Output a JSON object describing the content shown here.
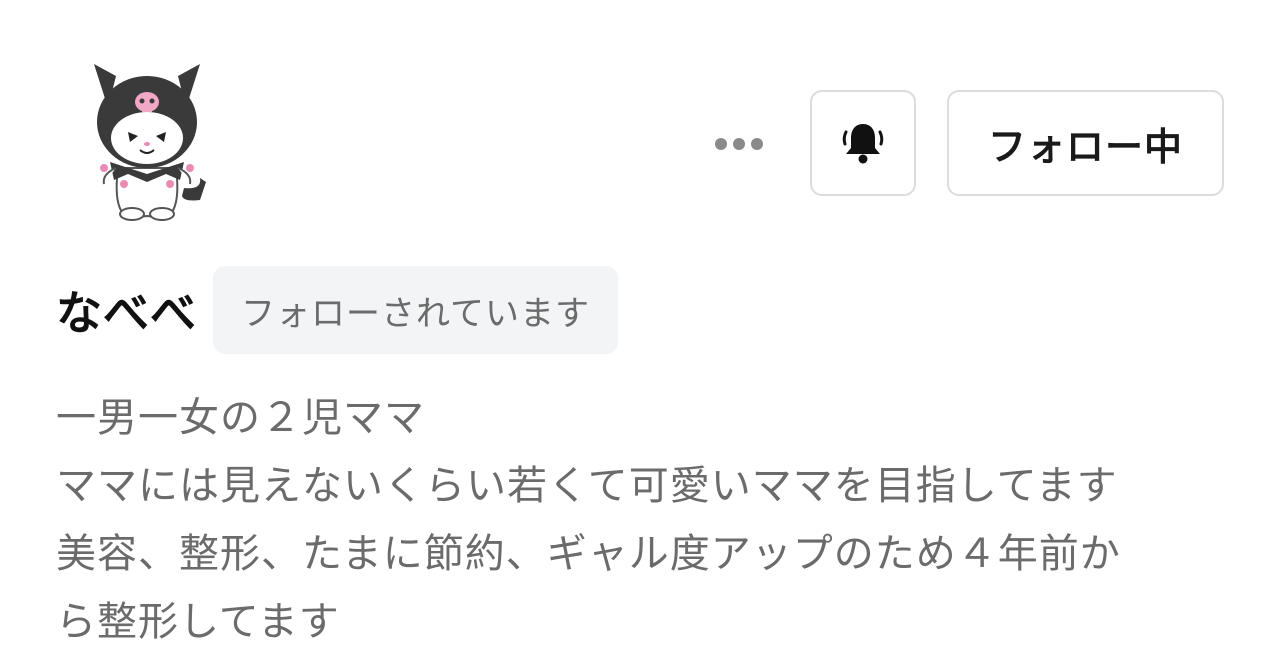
{
  "profile": {
    "name": "なべべ",
    "follows_you_badge": "フォローされています",
    "avatar_icon": "kuromi-character-avatar"
  },
  "actions": {
    "more_icon": "more-horizontal-icon",
    "bell_icon": "bell-filled-icon",
    "follow_label": "フォロー中"
  },
  "bio": {
    "lines": [
      "一男一女の２児ママ",
      "ママには見えないくらい若くて可愛いママを目指してます",
      "美容、整形、たまに節約、ギャル度アップのため４年前か",
      "ら整形してます"
    ]
  },
  "colors": {
    "text_primary": "#111111",
    "text_secondary": "#6b6b6b",
    "border": "#dcdcdc",
    "badge_bg": "#f3f4f6"
  }
}
